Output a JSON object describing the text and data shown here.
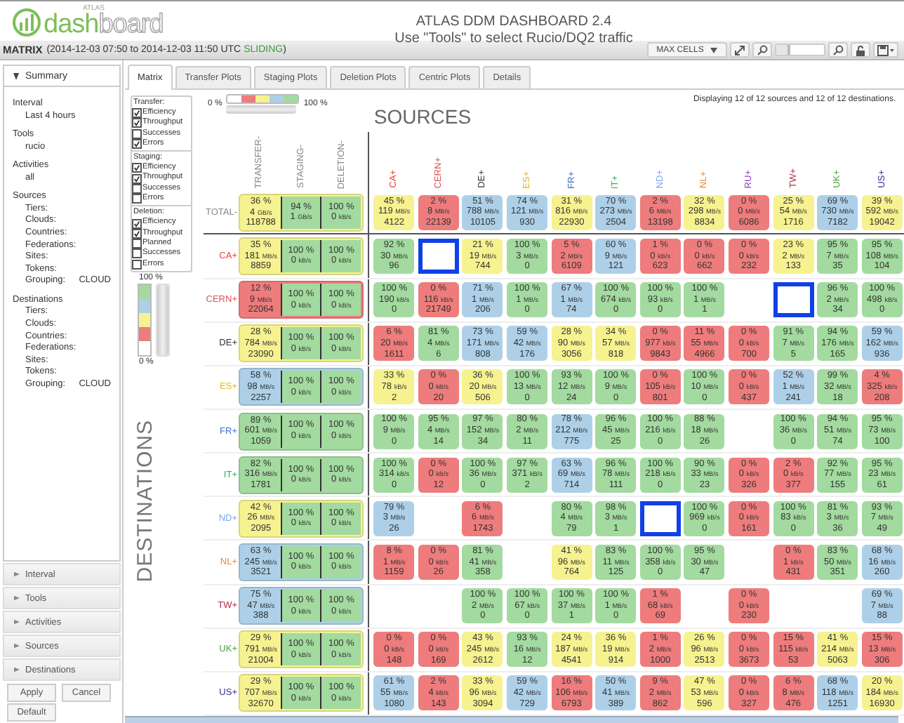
{
  "header": {
    "logo": {
      "small": "ATLAS",
      "word_1": "dash",
      "word_2": "board"
    },
    "title": "ATLAS DDM DASHBOARD 2.4",
    "subtitle": "Use \"Tools\" to select Rucio/DQ2 traffic"
  },
  "panel": {
    "title": "MATRIX",
    "range": "(2014-12-03 07:50 to 2014-12-03 11:50 UTC",
    "mode": "SLIDING",
    "range_end": ")",
    "max_cells": "MAX CELLS",
    "zoom": {
      "level": 0.3
    }
  },
  "summary": {
    "title": "Summary",
    "expanded": true,
    "sections": [
      {
        "label": "Interval",
        "items": [
          {
            "text": "Last 4 hours"
          }
        ]
      },
      {
        "label": "Tools",
        "items": [
          {
            "text": "rucio"
          }
        ]
      },
      {
        "label": "Activities",
        "items": [
          {
            "text": "all"
          }
        ]
      },
      {
        "label": "Sources",
        "items": [
          {
            "text": "Tiers:"
          },
          {
            "text": "Clouds:"
          },
          {
            "text": "Countries:"
          },
          {
            "text": "Federations:"
          },
          {
            "text": "Sites:"
          },
          {
            "text": "Tokens:"
          },
          {
            "text": "Grouping:",
            "value": "CLOUD"
          }
        ]
      },
      {
        "label": "Destinations",
        "items": [
          {
            "text": "Tiers:"
          },
          {
            "text": "Clouds:"
          },
          {
            "text": "Countries:"
          },
          {
            "text": "Federations:"
          },
          {
            "text": "Sites:"
          },
          {
            "text": "Tokens:"
          },
          {
            "text": "Grouping:",
            "value": "CLOUD"
          }
        ]
      }
    ]
  },
  "accordion": [
    {
      "label": "Interval",
      "expanded": false
    },
    {
      "label": "Tools",
      "expanded": false
    },
    {
      "label": "Activities",
      "expanded": false
    },
    {
      "label": "Sources",
      "expanded": false
    },
    {
      "label": "Destinations",
      "expanded": false
    }
  ],
  "buttons": [
    "Apply",
    "Cancel",
    "Default"
  ],
  "tabs": [
    {
      "label": "Matrix",
      "selected": true
    },
    {
      "label": "Transfer Plots",
      "selected": false
    },
    {
      "label": "Staging Plots",
      "selected": false
    },
    {
      "label": "Deletion Plots",
      "selected": false
    },
    {
      "label": "Centric Plots",
      "selected": false
    },
    {
      "label": "Details",
      "selected": false
    }
  ],
  "options": [
    {
      "label": "Transfer:",
      "items": [
        {
          "label": "Efficiency",
          "checked": true
        },
        {
          "label": "Throughput",
          "checked": true
        },
        {
          "label": "Successes",
          "checked": false
        },
        {
          "label": "Errors",
          "checked": true
        }
      ]
    },
    {
      "label": "Staging:",
      "items": [
        {
          "label": "Efficiency",
          "checked": true
        },
        {
          "label": "Throughput",
          "checked": true
        },
        {
          "label": "Successes",
          "checked": false
        },
        {
          "label": "Errors",
          "checked": false
        }
      ]
    },
    {
      "label": "Deletion:",
      "items": [
        {
          "label": "Efficiency",
          "checked": true
        },
        {
          "label": "Throughput",
          "checked": true
        },
        {
          "label": "Planned",
          "checked": false
        },
        {
          "label": "Successes",
          "checked": false
        },
        {
          "label": "Errors",
          "checked": false
        }
      ]
    }
  ],
  "legend": {
    "min": "0 %",
    "max": "100 %",
    "level": 1
  },
  "scale": {
    "max": "100 %",
    "min": "0 %",
    "level": 1
  },
  "sources_title": "SOURCES",
  "destinations_title": "DESTINATIONS",
  "displaying": "Displaying 12 of 12 sources and 12 of 12 destinations.",
  "matrix": {
    "group_columns": [
      "TRANSFER-",
      "STAGING-",
      "DELETION-"
    ],
    "columns": [
      {
        "label": "CA+",
        "color": "#e8413c"
      },
      {
        "label": "CERN+",
        "color": "#d9535a"
      },
      {
        "label": "DE+",
        "color": "#333333"
      },
      {
        "label": "ES+",
        "color": "#e0b820"
      },
      {
        "label": "FR+",
        "color": "#3a73c8"
      },
      {
        "label": "IT+",
        "color": "#3aa860"
      },
      {
        "label": "ND+",
        "color": "#7aa8f0"
      },
      {
        "label": "NL+",
        "color": "#e88a3a"
      },
      {
        "label": "RU+",
        "color": "#9040c0"
      },
      {
        "label": "TW+",
        "color": "#b03040"
      },
      {
        "label": "UK+",
        "color": "#50a040"
      },
      {
        "label": "US+",
        "color": "#303090"
      }
    ],
    "rows": [
      {
        "label": "TOTAL-",
        "color": "#888888",
        "transfer": {
          "eff": "36 %",
          "rate": "4",
          "unit": "GB/s",
          "count": "118788",
          "color": "#f6f290"
        },
        "staging": {
          "eff": "94 %",
          "rate": "1",
          "unit": "GB/s",
          "color": "#a3da9f"
        },
        "deletion": {
          "eff": "100 %",
          "rate": "0",
          "unit": "kB/s",
          "color": "#a3da9f"
        },
        "cells": [
          {
            "eff": "45 %",
            "rate": "119",
            "unit": "MB/s",
            "count": "4122",
            "color": "#f6f290",
            "outlined": false
          },
          {
            "eff": "2 %",
            "rate": "8",
            "unit": "MB/s",
            "count": "22139",
            "color": "#ee7c7c",
            "outlined": false
          },
          {
            "eff": "51 %",
            "rate": "788",
            "unit": "MB/s",
            "count": "10105",
            "color": "#add0e8",
            "outlined": false
          },
          {
            "eff": "74 %",
            "rate": "121",
            "unit": "MB/s",
            "count": "930",
            "color": "#add0e8",
            "outlined": false
          },
          {
            "eff": "31 %",
            "rate": "816",
            "unit": "MB/s",
            "count": "22930",
            "color": "#f6f290",
            "outlined": false
          },
          {
            "eff": "70 %",
            "rate": "273",
            "unit": "MB/s",
            "count": "2504",
            "color": "#add0e8",
            "outlined": false
          },
          {
            "eff": "2 %",
            "rate": "6",
            "unit": "MB/s",
            "count": "13198",
            "color": "#ee7c7c",
            "outlined": false
          },
          {
            "eff": "32 %",
            "rate": "298",
            "unit": "MB/s",
            "count": "8834",
            "color": "#f6f290",
            "outlined": false
          },
          {
            "eff": "0 %",
            "rate": "0",
            "unit": "MB/s",
            "count": "6086",
            "color": "#ee7c7c",
            "outlined": false
          },
          {
            "eff": "25 %",
            "rate": "54",
            "unit": "MB/s",
            "count": "1716",
            "color": "#f6f290",
            "outlined": false
          },
          {
            "eff": "69 %",
            "rate": "730",
            "unit": "MB/s",
            "count": "7182",
            "color": "#add0e8",
            "outlined": false
          },
          {
            "eff": "39 %",
            "rate": "592",
            "unit": "MB/s",
            "count": "19042",
            "color": "#f6f290",
            "outlined": false
          }
        ]
      },
      {
        "label": "CA+",
        "color": "#e8413c",
        "transfer": {
          "eff": "35 %",
          "rate": "181",
          "unit": "MB/s",
          "count": "8859",
          "color": "#f6f290"
        },
        "staging": {
          "eff": "100 %",
          "rate": "0",
          "unit": "kB/s",
          "color": "#a3da9f"
        },
        "deletion": {
          "eff": "100 %",
          "rate": "0",
          "unit": "kB/s",
          "color": "#a3da9f"
        },
        "cells": [
          {
            "eff": "92 %",
            "rate": "30",
            "unit": "MB/s",
            "count": "96",
            "color": "#a3da9f",
            "outlined": false
          },
          {
            "outlined": true
          },
          {
            "eff": "21 %",
            "rate": "19",
            "unit": "MB/s",
            "count": "744",
            "color": "#f6f290",
            "outlined": false
          },
          {
            "eff": "100 %",
            "rate": "3",
            "unit": "MB/s",
            "count": "0",
            "color": "#a3da9f",
            "outlined": false
          },
          {
            "eff": "5 %",
            "rate": "2",
            "unit": "MB/s",
            "count": "6109",
            "color": "#ee7c7c",
            "outlined": false
          },
          {
            "eff": "60 %",
            "rate": "9",
            "unit": "MB/s",
            "count": "121",
            "color": "#add0e8",
            "outlined": false
          },
          {
            "eff": "1 %",
            "rate": "0",
            "unit": "kB/s",
            "count": "623",
            "color": "#ee7c7c",
            "outlined": false
          },
          {
            "eff": "0 %",
            "rate": "0",
            "unit": "kB/s",
            "count": "662",
            "color": "#ee7c7c",
            "outlined": false
          },
          {
            "eff": "0 %",
            "rate": "0",
            "unit": "kB/s",
            "count": "232",
            "color": "#ee7c7c",
            "outlined": false
          },
          {
            "eff": "23 %",
            "rate": "2",
            "unit": "MB/s",
            "count": "133",
            "color": "#f6f290",
            "outlined": false
          },
          {
            "eff": "95 %",
            "rate": "7",
            "unit": "MB/s",
            "count": "35",
            "color": "#a3da9f",
            "outlined": false
          },
          {
            "eff": "95 %",
            "rate": "108",
            "unit": "MB/s",
            "count": "104",
            "color": "#a3da9f",
            "outlined": false
          }
        ]
      },
      {
        "label": "CERN+",
        "color": "#d9535a",
        "transfer": {
          "eff": "12 %",
          "rate": "9",
          "unit": "MB/s",
          "count": "22064",
          "color": "#ee7c7c"
        },
        "staging": {
          "eff": "100 %",
          "rate": "0",
          "unit": "kB/s",
          "color": "#a3da9f"
        },
        "deletion": {
          "eff": "100 %",
          "rate": "0",
          "unit": "kB/s",
          "color": "#a3da9f"
        },
        "cells": [
          {
            "eff": "100 %",
            "rate": "190",
            "unit": "kB/s",
            "count": "0",
            "color": "#a3da9f",
            "outlined": false
          },
          {
            "eff": "0 %",
            "rate": "116",
            "unit": "kB/s",
            "count": "21749",
            "color": "#ee7c7c",
            "outlined": false
          },
          {
            "eff": "71 %",
            "rate": "1",
            "unit": "MB/s",
            "count": "206",
            "color": "#add0e8",
            "outlined": false
          },
          {
            "eff": "100 %",
            "rate": "1",
            "unit": "MB/s",
            "count": "0",
            "color": "#a3da9f",
            "outlined": false
          },
          {
            "eff": "67 %",
            "rate": "1",
            "unit": "MB/s",
            "count": "74",
            "color": "#add0e8",
            "outlined": false
          },
          {
            "eff": "100 %",
            "rate": "674",
            "unit": "kB/s",
            "count": "0",
            "color": "#a3da9f",
            "outlined": false
          },
          {
            "eff": "100 %",
            "rate": "93",
            "unit": "kB/s",
            "count": "0",
            "color": "#a3da9f",
            "outlined": false
          },
          {
            "eff": "100 %",
            "rate": "1",
            "unit": "MB/s",
            "count": "1",
            "color": "#a3da9f",
            "outlined": false
          },
          {
            "outlined": false
          },
          {
            "outlined": true
          },
          {
            "eff": "96 %",
            "rate": "2",
            "unit": "MB/s",
            "count": "34",
            "color": "#a3da9f",
            "outlined": false
          },
          {
            "eff": "100 %",
            "rate": "498",
            "unit": "kB/s",
            "count": "0",
            "color": "#a3da9f",
            "outlined": false
          }
        ]
      },
      {
        "label": "DE+",
        "color": "#333333",
        "transfer": {
          "eff": "28 %",
          "rate": "784",
          "unit": "MB/s",
          "count": "23090",
          "color": "#f6f290"
        },
        "staging": {
          "eff": "100 %",
          "rate": "0",
          "unit": "kB/s",
          "color": "#a3da9f"
        },
        "deletion": {
          "eff": "100 %",
          "rate": "0",
          "unit": "kB/s",
          "color": "#a3da9f"
        },
        "cells": [
          {
            "eff": "6 %",
            "rate": "20",
            "unit": "MB/s",
            "count": "1611",
            "color": "#ee7c7c",
            "outlined": false
          },
          {
            "eff": "81 %",
            "rate": "4",
            "unit": "MB/s",
            "count": "6",
            "color": "#a3da9f",
            "outlined": false
          },
          {
            "eff": "73 %",
            "rate": "171",
            "unit": "MB/s",
            "count": "808",
            "color": "#add0e8",
            "outlined": false
          },
          {
            "eff": "59 %",
            "rate": "42",
            "unit": "MB/s",
            "count": "176",
            "color": "#add0e8",
            "outlined": false
          },
          {
            "eff": "28 %",
            "rate": "90",
            "unit": "MB/s",
            "count": "3056",
            "color": "#f6f290",
            "outlined": false
          },
          {
            "eff": "34 %",
            "rate": "57",
            "unit": "MB/s",
            "count": "818",
            "color": "#f6f290",
            "outlined": false
          },
          {
            "eff": "0 %",
            "rate": "977",
            "unit": "kB/s",
            "count": "9843",
            "color": "#ee7c7c",
            "outlined": false
          },
          {
            "eff": "11 %",
            "rate": "55",
            "unit": "MB/s",
            "count": "4966",
            "color": "#ee7c7c",
            "outlined": false
          },
          {
            "eff": "0 %",
            "rate": "0",
            "unit": "kB/s",
            "count": "700",
            "color": "#ee7c7c",
            "outlined": false
          },
          {
            "eff": "91 %",
            "rate": "7",
            "unit": "MB/s",
            "count": "5",
            "color": "#a3da9f",
            "outlined": false
          },
          {
            "eff": "94 %",
            "rate": "176",
            "unit": "MB/s",
            "count": "165",
            "color": "#a3da9f",
            "outlined": false
          },
          {
            "eff": "59 %",
            "rate": "162",
            "unit": "MB/s",
            "count": "936",
            "color": "#add0e8",
            "outlined": false
          }
        ]
      },
      {
        "label": "ES+",
        "color": "#e0b820",
        "transfer": {
          "eff": "58 %",
          "rate": "98",
          "unit": "MB/s",
          "count": "2257",
          "color": "#add0e8"
        },
        "staging": {
          "eff": "100 %",
          "rate": "0",
          "unit": "kB/s",
          "color": "#a3da9f"
        },
        "deletion": {
          "eff": "100 %",
          "rate": "0",
          "unit": "kB/s",
          "color": "#a3da9f"
        },
        "cells": [
          {
            "eff": "33 %",
            "rate": "78",
            "unit": "kB/s",
            "count": "2",
            "color": "#f6f290",
            "outlined": false
          },
          {
            "eff": "0 %",
            "rate": "0",
            "unit": "kB/s",
            "count": "20",
            "color": "#ee7c7c",
            "outlined": false
          },
          {
            "eff": "36 %",
            "rate": "20",
            "unit": "MB/s",
            "count": "506",
            "color": "#f6f290",
            "outlined": false
          },
          {
            "eff": "100 %",
            "rate": "13",
            "unit": "MB/s",
            "count": "0",
            "color": "#a3da9f",
            "outlined": false
          },
          {
            "eff": "93 %",
            "rate": "12",
            "unit": "MB/s",
            "count": "24",
            "color": "#a3da9f",
            "outlined": false
          },
          {
            "eff": "100 %",
            "rate": "9",
            "unit": "MB/s",
            "count": "0",
            "color": "#a3da9f",
            "outlined": false
          },
          {
            "eff": "0 %",
            "rate": "105",
            "unit": "kB/s",
            "count": "801",
            "color": "#ee7c7c",
            "outlined": false
          },
          {
            "eff": "100 %",
            "rate": "10",
            "unit": "MB/s",
            "count": "0",
            "color": "#a3da9f",
            "outlined": false
          },
          {
            "eff": "0 %",
            "rate": "0",
            "unit": "kB/s",
            "count": "437",
            "color": "#ee7c7c",
            "outlined": false
          },
          {
            "eff": "52 %",
            "rate": "1",
            "unit": "MB/s",
            "count": "241",
            "color": "#add0e8",
            "outlined": false
          },
          {
            "eff": "99 %",
            "rate": "32",
            "unit": "MB/s",
            "count": "18",
            "color": "#a3da9f",
            "outlined": false
          },
          {
            "eff": "4 %",
            "rate": "325",
            "unit": "kB/s",
            "count": "208",
            "color": "#ee7c7c",
            "outlined": false
          }
        ]
      },
      {
        "label": "FR+",
        "color": "#3a73c8",
        "transfer": {
          "eff": "89 %",
          "rate": "601",
          "unit": "MB/s",
          "count": "1059",
          "color": "#a3da9f"
        },
        "staging": {
          "eff": "100 %",
          "rate": "0",
          "unit": "kB/s",
          "color": "#a3da9f"
        },
        "deletion": {
          "eff": "100 %",
          "rate": "0",
          "unit": "kB/s",
          "color": "#a3da9f"
        },
        "cells": [
          {
            "eff": "100 %",
            "rate": "9",
            "unit": "MB/s",
            "count": "0",
            "color": "#a3da9f",
            "outlined": false
          },
          {
            "eff": "95 %",
            "rate": "4",
            "unit": "MB/s",
            "count": "14",
            "color": "#a3da9f",
            "outlined": false
          },
          {
            "eff": "97 %",
            "rate": "152",
            "unit": "MB/s",
            "count": "34",
            "color": "#a3da9f",
            "outlined": false
          },
          {
            "eff": "80 %",
            "rate": "2",
            "unit": "MB/s",
            "count": "11",
            "color": "#a3da9f",
            "outlined": false
          },
          {
            "eff": "78 %",
            "rate": "212",
            "unit": "MB/s",
            "count": "775",
            "color": "#add0e8",
            "outlined": false
          },
          {
            "eff": "96 %",
            "rate": "45",
            "unit": "MB/s",
            "count": "25",
            "color": "#a3da9f",
            "outlined": false
          },
          {
            "eff": "100 %",
            "rate": "216",
            "unit": "kB/s",
            "count": "0",
            "color": "#a3da9f",
            "outlined": false
          },
          {
            "eff": "88 %",
            "rate": "18",
            "unit": "MB/s",
            "count": "26",
            "color": "#a3da9f",
            "outlined": false
          },
          {
            "outlined": false
          },
          {
            "eff": "100 %",
            "rate": "36",
            "unit": "MB/s",
            "count": "0",
            "color": "#a3da9f",
            "outlined": false
          },
          {
            "eff": "94 %",
            "rate": "51",
            "unit": "MB/s",
            "count": "74",
            "color": "#a3da9f",
            "outlined": false
          },
          {
            "eff": "95 %",
            "rate": "73",
            "unit": "MB/s",
            "count": "100",
            "color": "#a3da9f",
            "outlined": false
          }
        ]
      },
      {
        "label": "IT+",
        "color": "#3aa860",
        "transfer": {
          "eff": "82 %",
          "rate": "316",
          "unit": "MB/s",
          "count": "1781",
          "color": "#a3da9f"
        },
        "staging": {
          "eff": "100 %",
          "rate": "0",
          "unit": "kB/s",
          "color": "#a3da9f"
        },
        "deletion": {
          "eff": "100 %",
          "rate": "0",
          "unit": "kB/s",
          "color": "#a3da9f"
        },
        "cells": [
          {
            "eff": "100 %",
            "rate": "314",
            "unit": "kB/s",
            "count": "0",
            "color": "#a3da9f",
            "outlined": false
          },
          {
            "eff": "0 %",
            "rate": "0",
            "unit": "kB/s",
            "count": "12",
            "color": "#ee7c7c",
            "outlined": false
          },
          {
            "eff": "100 %",
            "rate": "36",
            "unit": "MB/s",
            "count": "0",
            "color": "#a3da9f",
            "outlined": false
          },
          {
            "eff": "97 %",
            "rate": "371",
            "unit": "kB/s",
            "count": "2",
            "color": "#a3da9f",
            "outlined": false
          },
          {
            "eff": "63 %",
            "rate": "69",
            "unit": "MB/s",
            "count": "714",
            "color": "#add0e8",
            "outlined": false
          },
          {
            "eff": "96 %",
            "rate": "78",
            "unit": "MB/s",
            "count": "111",
            "color": "#a3da9f",
            "outlined": false
          },
          {
            "eff": "100 %",
            "rate": "218",
            "unit": "kB/s",
            "count": "0",
            "color": "#a3da9f",
            "outlined": false
          },
          {
            "eff": "90 %",
            "rate": "33",
            "unit": "MB/s",
            "count": "23",
            "color": "#a3da9f",
            "outlined": false
          },
          {
            "eff": "0 %",
            "rate": "0",
            "unit": "kB/s",
            "count": "326",
            "color": "#ee7c7c",
            "outlined": false
          },
          {
            "eff": "2 %",
            "rate": "0",
            "unit": "kB/s",
            "count": "377",
            "color": "#ee7c7c",
            "outlined": false
          },
          {
            "eff": "92 %",
            "rate": "77",
            "unit": "MB/s",
            "count": "155",
            "color": "#a3da9f",
            "outlined": false
          },
          {
            "eff": "95 %",
            "rate": "23",
            "unit": "MB/s",
            "count": "61",
            "color": "#a3da9f",
            "outlined": false
          }
        ]
      },
      {
        "label": "ND+",
        "color": "#7aa8f0",
        "transfer": {
          "eff": "42 %",
          "rate": "26",
          "unit": "MB/s",
          "count": "2095",
          "color": "#f6f290"
        },
        "staging": {
          "eff": "100 %",
          "rate": "0",
          "unit": "kB/s",
          "color": "#a3da9f"
        },
        "deletion": {
          "eff": "100 %",
          "rate": "0",
          "unit": "kB/s",
          "color": "#a3da9f"
        },
        "cells": [
          {
            "eff": "79 %",
            "rate": "3",
            "unit": "MB/s",
            "count": "26",
            "color": "#add0e8",
            "outlined": false
          },
          {
            "outlined": false
          },
          {
            "eff": "6 %",
            "rate": "6",
            "unit": "MB/s",
            "count": "1743",
            "color": "#ee7c7c",
            "outlined": false
          },
          {
            "outlined": false
          },
          {
            "eff": "80 %",
            "rate": "4",
            "unit": "MB/s",
            "count": "79",
            "color": "#a3da9f",
            "outlined": false
          },
          {
            "eff": "98 %",
            "rate": "3",
            "unit": "MB/s",
            "count": "1",
            "color": "#a3da9f",
            "outlined": false
          },
          {
            "outlined": true
          },
          {
            "eff": "100 %",
            "rate": "969",
            "unit": "kB/s",
            "count": "0",
            "color": "#a3da9f",
            "outlined": false
          },
          {
            "eff": "0 %",
            "rate": "0",
            "unit": "kB/s",
            "count": "161",
            "color": "#ee7c7c",
            "outlined": false
          },
          {
            "eff": "100 %",
            "rate": "83",
            "unit": "kB/s",
            "count": "0",
            "color": "#a3da9f",
            "outlined": false
          },
          {
            "eff": "81 %",
            "rate": "3",
            "unit": "MB/s",
            "count": "36",
            "color": "#a3da9f",
            "outlined": false
          },
          {
            "eff": "93 %",
            "rate": "7",
            "unit": "MB/s",
            "count": "49",
            "color": "#a3da9f",
            "outlined": false
          }
        ]
      },
      {
        "label": "NL+",
        "color": "#e88a3a",
        "transfer": {
          "eff": "63 %",
          "rate": "245",
          "unit": "MB/s",
          "count": "3521",
          "color": "#add0e8"
        },
        "staging": {
          "eff": "100 %",
          "rate": "0",
          "unit": "kB/s",
          "color": "#a3da9f"
        },
        "deletion": {
          "eff": "100 %",
          "rate": "0",
          "unit": "kB/s",
          "color": "#a3da9f"
        },
        "cells": [
          {
            "eff": "8 %",
            "rate": "1",
            "unit": "MB/s",
            "count": "1159",
            "color": "#ee7c7c",
            "outlined": false
          },
          {
            "eff": "0 %",
            "rate": "0",
            "unit": "kB/s",
            "count": "26",
            "color": "#ee7c7c",
            "outlined": false
          },
          {
            "eff": "81 %",
            "rate": "41",
            "unit": "MB/s",
            "count": "358",
            "color": "#a3da9f",
            "outlined": false
          },
          {
            "outlined": false
          },
          {
            "eff": "41 %",
            "rate": "96",
            "unit": "MB/s",
            "count": "764",
            "color": "#f6f290",
            "outlined": false
          },
          {
            "eff": "83 %",
            "rate": "11",
            "unit": "MB/s",
            "count": "125",
            "color": "#a3da9f",
            "outlined": false
          },
          {
            "eff": "100 %",
            "rate": "358",
            "unit": "kB/s",
            "count": "0",
            "color": "#a3da9f",
            "outlined": false
          },
          {
            "eff": "95 %",
            "rate": "30",
            "unit": "MB/s",
            "count": "47",
            "color": "#a3da9f",
            "outlined": false
          },
          {
            "outlined": false
          },
          {
            "eff": "0 %",
            "rate": "1",
            "unit": "kB/s",
            "count": "431",
            "color": "#ee7c7c",
            "outlined": false
          },
          {
            "eff": "83 %",
            "rate": "50",
            "unit": "MB/s",
            "count": "351",
            "color": "#a3da9f",
            "outlined": false
          },
          {
            "eff": "68 %",
            "rate": "16",
            "unit": "MB/s",
            "count": "260",
            "color": "#add0e8",
            "outlined": false
          }
        ]
      },
      {
        "label": "TW+",
        "color": "#b03040",
        "transfer": {
          "eff": "75 %",
          "rate": "47",
          "unit": "MB/s",
          "count": "388",
          "color": "#add0e8"
        },
        "staging": {
          "eff": "100 %",
          "rate": "0",
          "unit": "kB/s",
          "color": "#a3da9f"
        },
        "deletion": {
          "eff": "100 %",
          "rate": "0",
          "unit": "kB/s",
          "color": "#a3da9f"
        },
        "cells": [
          {
            "outlined": false
          },
          {
            "outlined": false
          },
          {
            "eff": "100 %",
            "rate": "2",
            "unit": "MB/s",
            "count": "0",
            "color": "#a3da9f",
            "outlined": false
          },
          {
            "eff": "100 %",
            "rate": "67",
            "unit": "kB/s",
            "count": "0",
            "color": "#a3da9f",
            "outlined": false
          },
          {
            "eff": "100 %",
            "rate": "37",
            "unit": "MB/s",
            "count": "1",
            "color": "#a3da9f",
            "outlined": false
          },
          {
            "eff": "100 %",
            "rate": "1",
            "unit": "MB/s",
            "count": "0",
            "color": "#a3da9f",
            "outlined": false
          },
          {
            "eff": "1 %",
            "rate": "68",
            "unit": "kB/s",
            "count": "69",
            "color": "#ee7c7c",
            "outlined": false
          },
          {
            "outlined": false
          },
          {
            "eff": "0 %",
            "rate": "0",
            "unit": "kB/s",
            "count": "230",
            "color": "#ee7c7c",
            "outlined": false
          },
          {
            "outlined": false
          },
          {
            "outlined": false
          },
          {
            "eff": "69 %",
            "rate": "7",
            "unit": "MB/s",
            "count": "88",
            "color": "#add0e8",
            "outlined": false
          }
        ]
      },
      {
        "label": "UK+",
        "color": "#50a040",
        "transfer": {
          "eff": "29 %",
          "rate": "791",
          "unit": "MB/s",
          "count": "21004",
          "color": "#f6f290"
        },
        "staging": {
          "eff": "100 %",
          "rate": "0",
          "unit": "kB/s",
          "color": "#a3da9f"
        },
        "deletion": {
          "eff": "100 %",
          "rate": "0",
          "unit": "kB/s",
          "color": "#a3da9f"
        },
        "cells": [
          {
            "eff": "0 %",
            "rate": "0",
            "unit": "kB/s",
            "count": "148",
            "color": "#ee7c7c",
            "outlined": false
          },
          {
            "eff": "0 %",
            "rate": "0",
            "unit": "kB/s",
            "count": "169",
            "color": "#ee7c7c",
            "outlined": false
          },
          {
            "eff": "43 %",
            "rate": "245",
            "unit": "MB/s",
            "count": "2612",
            "color": "#f6f290",
            "outlined": false
          },
          {
            "eff": "93 %",
            "rate": "16",
            "unit": "MB/s",
            "count": "12",
            "color": "#a3da9f",
            "outlined": false
          },
          {
            "eff": "24 %",
            "rate": "187",
            "unit": "MB/s",
            "count": "4541",
            "color": "#f6f290",
            "outlined": false
          },
          {
            "eff": "36 %",
            "rate": "19",
            "unit": "MB/s",
            "count": "914",
            "color": "#f6f290",
            "outlined": false
          },
          {
            "eff": "1 %",
            "rate": "2",
            "unit": "MB/s",
            "count": "1000",
            "color": "#ee7c7c",
            "outlined": false
          },
          {
            "eff": "26 %",
            "rate": "96",
            "unit": "MB/s",
            "count": "2513",
            "color": "#f6f290",
            "outlined": false
          },
          {
            "eff": "0 %",
            "rate": "0",
            "unit": "kB/s",
            "count": "3673",
            "color": "#ee7c7c",
            "outlined": false
          },
          {
            "eff": "15 %",
            "rate": "115",
            "unit": "kB/s",
            "count": "53",
            "color": "#ee7c7c",
            "outlined": false
          },
          {
            "eff": "41 %",
            "rate": "214",
            "unit": "MB/s",
            "count": "5063",
            "color": "#f6f290",
            "outlined": false
          },
          {
            "eff": "15 %",
            "rate": "13",
            "unit": "MB/s",
            "count": "306",
            "color": "#ee7c7c",
            "outlined": false
          }
        ]
      },
      {
        "label": "US+",
        "color": "#303090",
        "transfer": {
          "eff": "29 %",
          "rate": "707",
          "unit": "MB/s",
          "count": "32670",
          "color": "#f6f290"
        },
        "staging": {
          "eff": "100 %",
          "rate": "0",
          "unit": "kB/s",
          "color": "#a3da9f"
        },
        "deletion": {
          "eff": "100 %",
          "rate": "0",
          "unit": "kB/s",
          "color": "#a3da9f"
        },
        "cells": [
          {
            "eff": "61 %",
            "rate": "55",
            "unit": "MB/s",
            "count": "1080",
            "color": "#add0e8",
            "outlined": false
          },
          {
            "eff": "2 %",
            "rate": "4",
            "unit": "kB/s",
            "count": "143",
            "color": "#ee7c7c",
            "outlined": false
          },
          {
            "eff": "33 %",
            "rate": "96",
            "unit": "MB/s",
            "count": "3094",
            "color": "#f6f290",
            "outlined": false
          },
          {
            "eff": "59 %",
            "rate": "42",
            "unit": "MB/s",
            "count": "729",
            "color": "#add0e8",
            "outlined": false
          },
          {
            "eff": "16 %",
            "rate": "106",
            "unit": "MB/s",
            "count": "6793",
            "color": "#ee7c7c",
            "outlined": false
          },
          {
            "eff": "50 %",
            "rate": "41",
            "unit": "MB/s",
            "count": "389",
            "color": "#add0e8",
            "outlined": false
          },
          {
            "eff": "9 %",
            "rate": "2",
            "unit": "MB/s",
            "count": "862",
            "color": "#ee7c7c",
            "outlined": false
          },
          {
            "eff": "47 %",
            "rate": "53",
            "unit": "MB/s",
            "count": "596",
            "color": "#f6f290",
            "outlined": false
          },
          {
            "eff": "0 %",
            "rate": "0",
            "unit": "kB/s",
            "count": "327",
            "color": "#ee7c7c",
            "outlined": false
          },
          {
            "eff": "6 %",
            "rate": "8",
            "unit": "MB/s",
            "count": "476",
            "color": "#ee7c7c",
            "outlined": false
          },
          {
            "eff": "68 %",
            "rate": "118",
            "unit": "MB/s",
            "count": "1251",
            "color": "#add0e8",
            "outlined": false
          },
          {
            "eff": "20 %",
            "rate": "184",
            "unit": "MB/s",
            "count": "16930",
            "color": "#f6f290",
            "outlined": false
          }
        ]
      }
    ]
  }
}
